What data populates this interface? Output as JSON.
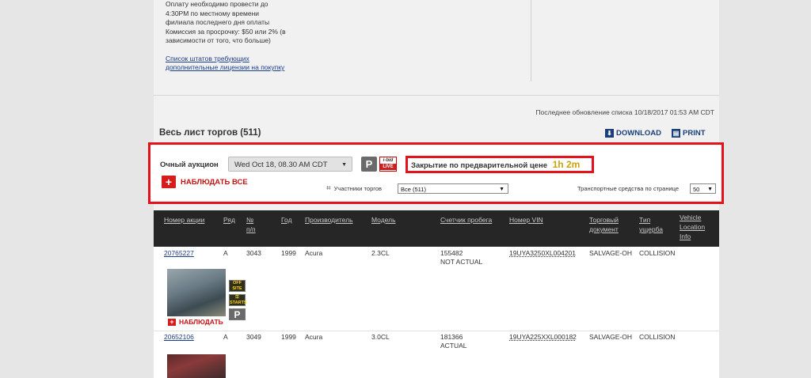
{
  "notice": {
    "lines": [
      "Оплату необходимо провести до",
      "4:30PM по местному времени",
      "филиала последнего дня оплаты",
      "Комиссия за просрочку: $50 или 2% (в",
      "зависимости от того, что больше)"
    ],
    "link_line1": "Список штатов требующих",
    "link_line2": "дополнительные лицензии на покупку"
  },
  "updated_text": "Последнее обновление списка 10/18/2017 01:53 AM CDT",
  "list_title": "Весь лист торгов (511)",
  "actions": {
    "download": "DOWNLOAD",
    "print": "PRINT"
  },
  "filter": {
    "auction_label": "Очный аукцион",
    "auction_value": "Wed Oct 18, 08.30 AM CDT",
    "p_badge": "P",
    "ibid_top": "i-bid",
    "ibid_bottom": "LIVE",
    "closing_label": "Закрытие по предварительной цене",
    "closing_time": "1h 2m",
    "watch_all": "НАБЛЮДАТЬ ВСЕ",
    "participants_label": "Участники торгов",
    "participants_value": "Все (511)",
    "vehicles_label": "Транспортные средства по странице",
    "vehicles_value": "50"
  },
  "table": {
    "headers": {
      "lot": "Номер акции",
      "row": "Ряд",
      "num": [
        "№",
        "п/п"
      ],
      "year": "Год",
      "make": "Производитель",
      "model": "Модель",
      "odometer": "Счетчик пробега",
      "vin": "Номер VIN",
      "doc": [
        "Торговый",
        "документ"
      ],
      "damage": [
        "Тип",
        "ущерба"
      ],
      "location": [
        "Vehicle",
        "Location",
        "Info"
      ]
    },
    "rows": [
      {
        "lot": "20765227",
        "row": "A",
        "num": "3043",
        "year": "1999",
        "make": "Acura",
        "model": "2.3CL",
        "odometer": "155482",
        "odometer_note": "NOT ACTUAL",
        "vin": "19UYA3250XL004201",
        "doc": "SALVAGE-OH",
        "damage": "COLLISION",
        "watch": "НАБЛЮДАТЬ",
        "badge_off": [
          "OFF",
          "SITE"
        ],
        "badge_starts": [
          "",
          "STARTS"
        ],
        "badge_p": "P"
      },
      {
        "lot": "20652106",
        "row": "A",
        "num": "3049",
        "year": "1999",
        "make": "Acura",
        "model": "3.0CL",
        "odometer": "181366",
        "odometer_note": "ACTUAL",
        "vin": "19UYA225XXL000182",
        "doc": "SALVAGE-OH",
        "damage": "COLLISION"
      }
    ]
  },
  "colors": {
    "accent_red": "#e4131b",
    "header_bg": "#262626",
    "link_blue": "#1a3d8a",
    "timer_gold": "#c9a20c"
  }
}
